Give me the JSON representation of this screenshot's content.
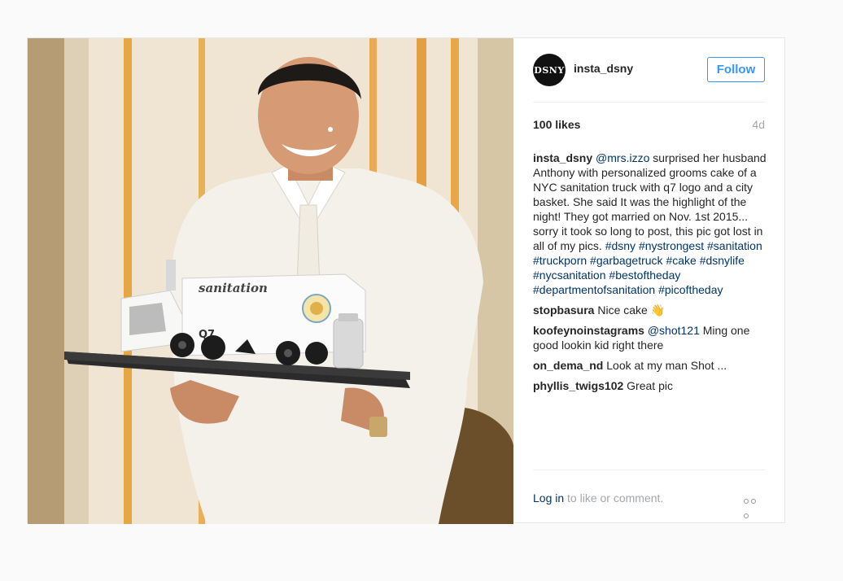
{
  "post": {
    "username": "insta_dsny",
    "avatar_text": "DSNY",
    "follow_label": "Follow",
    "likes": "100 likes",
    "age": "4d",
    "cake_text": "sanitation",
    "cake_number": "Q7"
  },
  "caption": {
    "user": "insta_dsny",
    "mention": "@mrs.izzo",
    "text": " surprised her husband Anthony with personalized grooms cake of a NYC sanitation truck with q7 logo and a city basket. She said It was the highlight of the night! They got married on Nov. 1st 2015... sorry it took so long to post, this pic got lost in all of my pics. ",
    "hashtags": [
      "#dsny",
      "#nystrongest",
      "#sanitation",
      "#truckporn",
      "#garbagetruck",
      "#cake",
      "#dsnylife",
      "#nycsanitation",
      "#bestoftheday",
      "#departmentofsanitation",
      "#picoftheday"
    ]
  },
  "comments": [
    {
      "user": "stopbasura",
      "text": "Nice cake ",
      "emoji": "👋"
    },
    {
      "user": "koofeynoinstagrams",
      "mention": "@shot121",
      "text": " Ming one good lookin kid right there"
    },
    {
      "user": "on_dema_nd",
      "text": "Look at my man Shot ..."
    },
    {
      "user": "phyllis_twigs102",
      "text": "Great pic"
    }
  ],
  "footer": {
    "login_link": "Log in",
    "login_rest": " to like or comment."
  },
  "icons": {
    "more": "more-options-icon"
  },
  "colors": {
    "link": "#003569",
    "follow": "#3897f0",
    "muted": "#a5a7aa"
  }
}
